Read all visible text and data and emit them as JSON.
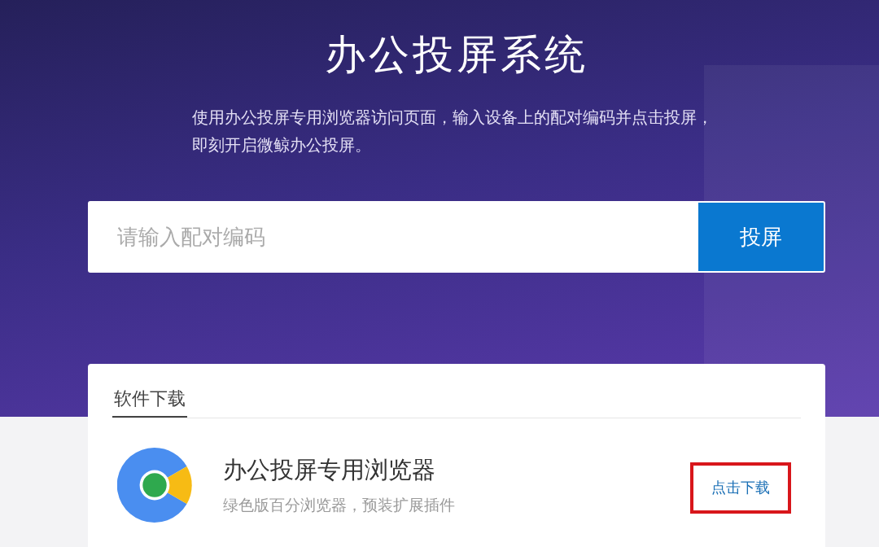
{
  "header": {
    "title": "办公投屏系统",
    "description": "使用办公投屏专用浏览器访问页面，输入设备上的配对编码并点击投屏，即刻开启微鲸办公投屏。"
  },
  "pairing": {
    "placeholder": "请输入配对编码",
    "button": "投屏"
  },
  "downloads": {
    "tabs": [
      {
        "label": "软件下载",
        "selected": true
      }
    ],
    "items": [
      {
        "name": "办公投屏专用浏览器",
        "description": "绿色版百分浏览器，预装扩展插件",
        "button": "点击下载",
        "highlighted": true
      }
    ]
  }
}
